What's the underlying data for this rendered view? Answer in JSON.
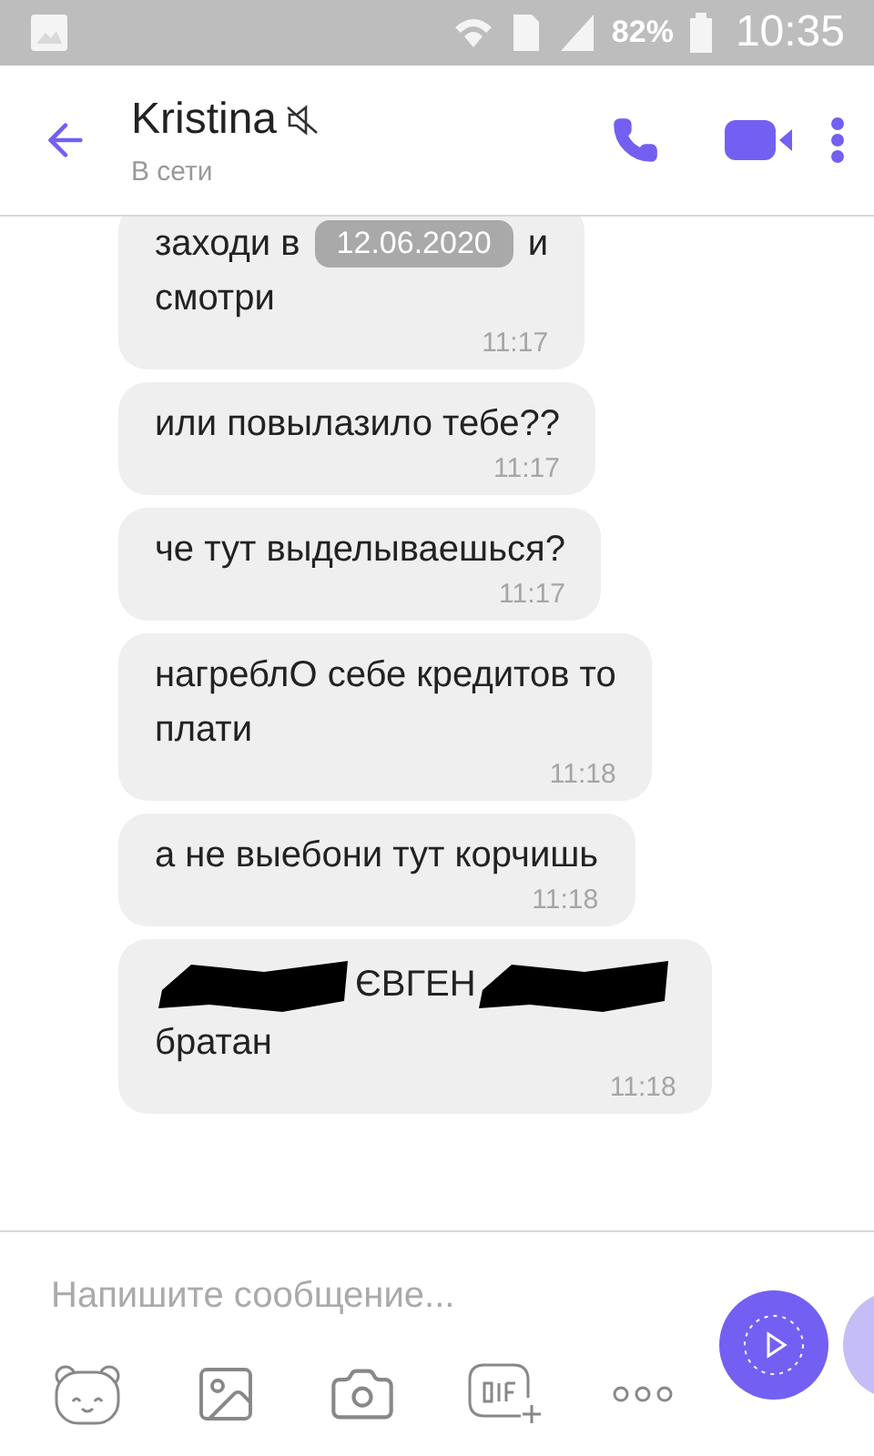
{
  "status_bar": {
    "battery": "82%",
    "time": "10:35"
  },
  "header": {
    "name": "Kristina",
    "muted": true,
    "status": "В сети"
  },
  "messages": [
    {
      "lines": [
        [
          {
            "kind": "text",
            "text": "заходи в"
          },
          {
            "kind": "date",
            "text": "12.06.2020"
          },
          {
            "kind": "text",
            "text": "и"
          }
        ],
        [
          {
            "kind": "text",
            "text": "смотри"
          }
        ]
      ],
      "time": "11:17"
    },
    {
      "lines": [
        [
          {
            "kind": "text",
            "text": "или повылазило тебе??"
          }
        ]
      ],
      "time": "11:17"
    },
    {
      "lines": [
        [
          {
            "kind": "text",
            "text": "че тут выделываешься?"
          }
        ]
      ],
      "time": "11:17"
    },
    {
      "lines": [
        [
          {
            "kind": "text",
            "text": "нагреблО себе кредитов то"
          }
        ],
        [
          {
            "kind": "text",
            "text": "плати"
          }
        ]
      ],
      "time": "11:18"
    },
    {
      "lines": [
        [
          {
            "kind": "text",
            "text": "а не выебони тут корчишь"
          }
        ]
      ],
      "time": "11:18"
    },
    {
      "lines": [
        [
          {
            "kind": "redacted"
          },
          {
            "kind": "text",
            "text": "ЄВГЕН"
          },
          {
            "kind": "redacted"
          }
        ],
        [
          {
            "kind": "text",
            "text": "братан"
          }
        ]
      ],
      "time": "11:18"
    }
  ],
  "composer": {
    "placeholder": "Напишите сообщение..."
  }
}
